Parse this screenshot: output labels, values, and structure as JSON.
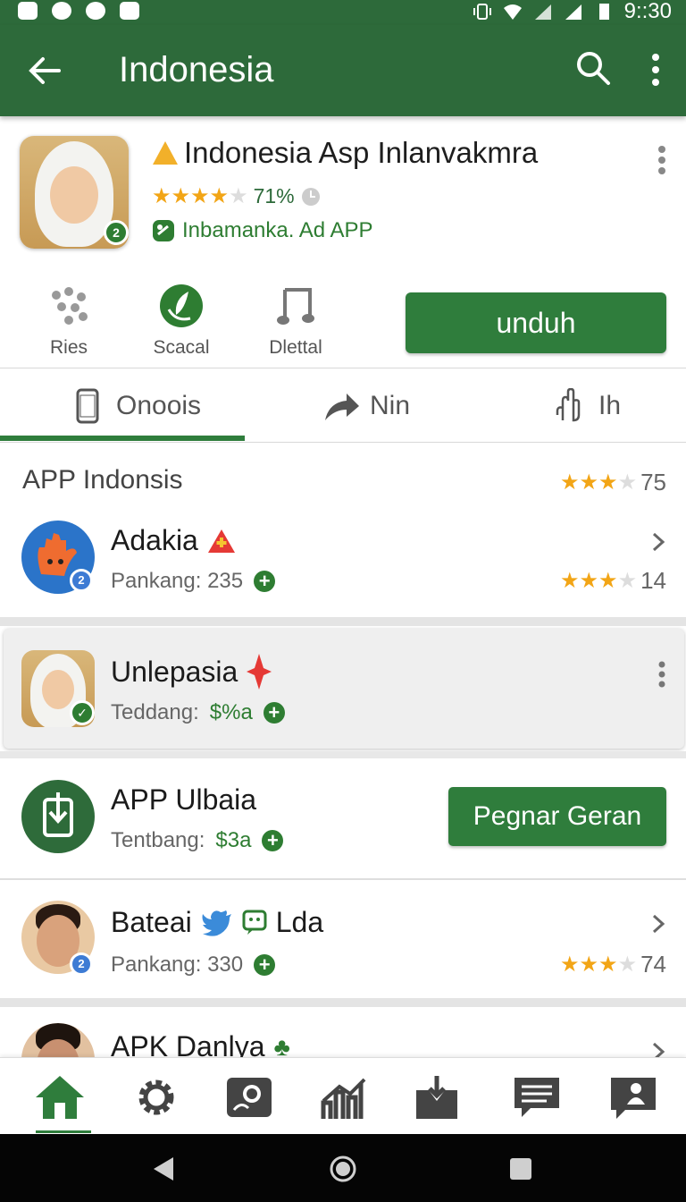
{
  "status_bar": {
    "time": "9::30"
  },
  "app_bar": {
    "title": "Indonesia"
  },
  "header": {
    "app_name": "Indonesia Asp Inlanvakmra",
    "rating_percent": "71%",
    "rating_stars": 4,
    "developer": "Inbamanka. Ad APP"
  },
  "quick_actions": [
    {
      "label": "Ries",
      "icon": "dots-cluster-icon"
    },
    {
      "label": "Scacal",
      "icon": "green-leaf-icon"
    },
    {
      "label": "Dlettal",
      "icon": "music-note-icon"
    }
  ],
  "install_button": "unduh",
  "tabs": [
    {
      "label": "Onoois",
      "icon": "phone-icon",
      "active": true
    },
    {
      "label": "Nin",
      "icon": "share-arrow-icon",
      "active": false
    },
    {
      "label": "Ih",
      "icon": "hand-pointer-icon",
      "active": false
    }
  ],
  "section": {
    "title": "APP Indonsis",
    "rating_value": "75",
    "rating_stars": 3
  },
  "list": [
    {
      "name": "Adakia",
      "sub_label": "Pankang: 235",
      "sub_value": "",
      "rating": "14",
      "rating_stars": 3,
      "badge_icon": "red-warning-icon"
    },
    {
      "name": "Unlepasia",
      "sub_label": "Teddang: ",
      "sub_value": "$%a",
      "badge_icon": "red-star-icon"
    },
    {
      "name": "APP Ulbaia",
      "sub_label": "Tentbang: ",
      "sub_value": "$3a",
      "action": "Pegnar Geran"
    },
    {
      "name": "Bateai",
      "name_extra": "Lda",
      "sub_label": "Pankang: 330",
      "sub_value": "",
      "rating": "74",
      "rating_stars": 3
    },
    {
      "name": "APK Danlya"
    }
  ],
  "colors": {
    "primary": "#2d6a3a",
    "button": "#2f7d3c",
    "star": "#f2a516",
    "accent_red": "#e53935"
  }
}
